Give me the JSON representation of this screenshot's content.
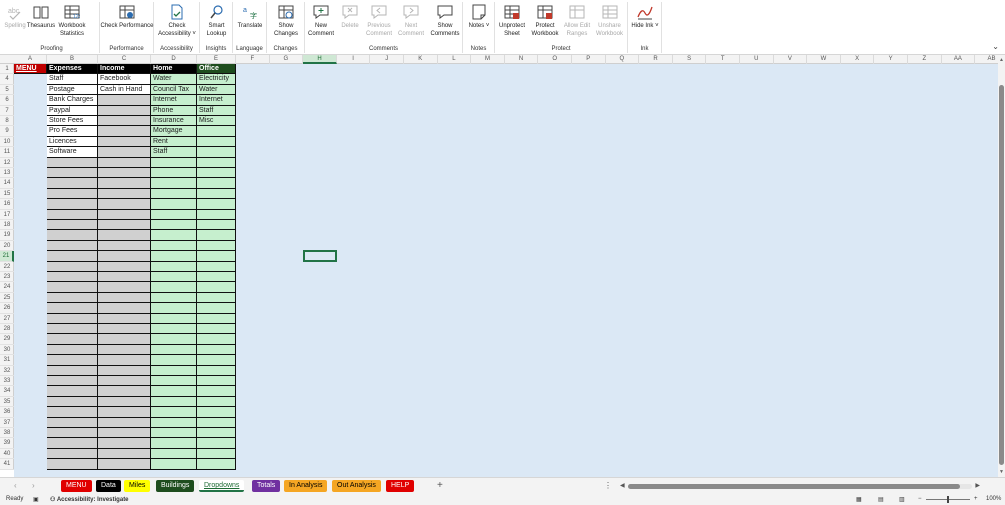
{
  "ribbon": {
    "groups": [
      {
        "label": "Proofing",
        "buttons": [
          {
            "label": "Spelling",
            "icon": "spelling-icon",
            "disabled": true
          },
          {
            "label": "Thesaurus",
            "icon": "thesaurus-icon",
            "disabled": false
          },
          {
            "label": "Workbook Statistics",
            "icon": "workbook-statistics-icon",
            "disabled": false
          }
        ]
      },
      {
        "label": "Performance",
        "buttons": [
          {
            "label": "Check Performance",
            "icon": "check-performance-icon",
            "disabled": false
          }
        ]
      },
      {
        "label": "Accessibility",
        "buttons": [
          {
            "label": "Check Accessibility ˅",
            "icon": "check-accessibility-icon",
            "disabled": false
          }
        ]
      },
      {
        "label": "Insights",
        "buttons": [
          {
            "label": "Smart Lookup",
            "icon": "smart-lookup-icon",
            "disabled": false
          }
        ]
      },
      {
        "label": "Language",
        "buttons": [
          {
            "label": "Translate",
            "icon": "translate-icon",
            "disabled": false
          }
        ]
      },
      {
        "label": "Changes",
        "buttons": [
          {
            "label": "Show Changes",
            "icon": "show-changes-icon",
            "disabled": false
          }
        ]
      },
      {
        "label": "Comments",
        "buttons": [
          {
            "label": "New Comment",
            "icon": "new-comment-icon",
            "disabled": false
          },
          {
            "label": "Delete",
            "icon": "delete-comment-icon",
            "disabled": true
          },
          {
            "label": "Previous Comment",
            "icon": "previous-comment-icon",
            "disabled": true
          },
          {
            "label": "Next Comment",
            "icon": "next-comment-icon",
            "disabled": true
          },
          {
            "label": "Show Comments",
            "icon": "show-comments-icon",
            "disabled": false
          }
        ]
      },
      {
        "label": "Notes",
        "buttons": [
          {
            "label": "Notes ˅",
            "icon": "notes-icon",
            "disabled": false
          }
        ]
      },
      {
        "label": "Protect",
        "buttons": [
          {
            "label": "Unprotect Sheet",
            "icon": "unprotect-sheet-icon",
            "disabled": false
          },
          {
            "label": "Protect Workbook",
            "icon": "protect-workbook-icon",
            "disabled": false
          },
          {
            "label": "Allow Edit Ranges",
            "icon": "allow-edit-ranges-icon",
            "disabled": true
          },
          {
            "label": "Unshare Workbook",
            "icon": "unshare-workbook-icon",
            "disabled": true
          }
        ]
      },
      {
        "label": "Ink",
        "buttons": [
          {
            "label": "Hide Ink ˅",
            "icon": "hide-ink-icon",
            "disabled": false
          }
        ]
      }
    ]
  },
  "columns": [
    "A",
    "B",
    "C",
    "D",
    "E",
    "F",
    "G",
    "H",
    "I",
    "J",
    "K",
    "L",
    "M",
    "N",
    "O",
    "P",
    "Q",
    "R",
    "S",
    "T",
    "U",
    "V",
    "W",
    "X",
    "Y",
    "Z",
    "AA",
    "AB"
  ],
  "selected_column": "H",
  "selected_row": 21,
  "rows": [
    1,
    4,
    5,
    6,
    7,
    8,
    9,
    10,
    11,
    12,
    13,
    14,
    15,
    16,
    17,
    18,
    19,
    20,
    21,
    22,
    23,
    24,
    25,
    26,
    27,
    28,
    29,
    30,
    31,
    32,
    33,
    34,
    35,
    36,
    37,
    38,
    39,
    40,
    41
  ],
  "sheet": {
    "menu_cell": "MENU",
    "headers": {
      "expenses": "Expenses",
      "income": "Income",
      "home": "Home",
      "office": "Office"
    },
    "expenses": [
      "Staff",
      "Postage",
      "Bank Charges",
      "Paypal",
      "Store Fees",
      "Pro Fees",
      "Licences",
      "Software"
    ],
    "income": [
      "Facebook",
      "Cash in Hand"
    ],
    "home": [
      "Water",
      "Council Tax",
      "Internet",
      "Phone",
      "Insurance",
      "Mortgage",
      "Rent",
      "Staff"
    ],
    "office": [
      "Electricity",
      "Water",
      "Internet",
      "Staff",
      "Misc"
    ]
  },
  "tabs": [
    {
      "label": "MENU",
      "bg": "#e00000",
      "fg": "#ffffff"
    },
    {
      "label": "Data",
      "bg": "#000000",
      "fg": "#ffffff"
    },
    {
      "label": "Miles",
      "bg": "#ffff00",
      "fg": "#000000"
    },
    {
      "label": "Buildings",
      "bg": "#1e4d1e",
      "fg": "#ffffff"
    },
    {
      "label": "Dropdowns",
      "bg": "#ffffff",
      "fg": "#1d6b34",
      "active": true
    },
    {
      "label": "Totals",
      "bg": "#7030a0",
      "fg": "#ffffff"
    },
    {
      "label": "In Analysis",
      "bg": "#f5a623",
      "fg": "#000000"
    },
    {
      "label": "Out Analysis",
      "bg": "#f5a623",
      "fg": "#000000"
    },
    {
      "label": "HELP",
      "bg": "#e00000",
      "fg": "#ffffff"
    }
  ],
  "status": {
    "ready": "Ready",
    "accessibility": "Accessibility: Investigate",
    "zoom": "100%",
    "zoom_minus": "−",
    "zoom_plus": "+"
  },
  "tabbar": {
    "add": "+",
    "more": "⋮",
    "prev": "‹",
    "next": "›"
  }
}
